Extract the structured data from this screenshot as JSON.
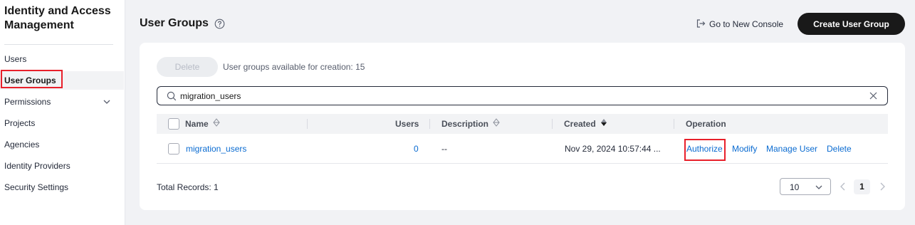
{
  "sidebar": {
    "title": "Identity and Access Management",
    "items": [
      {
        "label": "Users"
      },
      {
        "label": "User Groups"
      },
      {
        "label": "Permissions"
      },
      {
        "label": "Projects"
      },
      {
        "label": "Agencies"
      },
      {
        "label": "Identity Providers"
      },
      {
        "label": "Security Settings"
      }
    ]
  },
  "header": {
    "title": "User Groups",
    "go_new_console": "Go to New Console",
    "create_button": "Create User Group"
  },
  "toolbar": {
    "delete_label": "Delete",
    "available_text": "User groups available for creation: 15"
  },
  "search": {
    "value": "migration_users"
  },
  "table": {
    "columns": {
      "name": "Name",
      "users": "Users",
      "description": "Description",
      "created": "Created",
      "operation": "Operation"
    },
    "rows": [
      {
        "name": "migration_users",
        "users": "0",
        "description": "--",
        "created": "Nov 29, 2024 10:57:44 ...",
        "operations": [
          "Authorize",
          "Modify",
          "Manage User",
          "Delete"
        ]
      }
    ]
  },
  "footer": {
    "total_records": "Total Records: 1",
    "page_size": "10",
    "current_page": "1"
  },
  "colors": {
    "accent_link": "#0a6bd1",
    "primary_button": "#191919",
    "highlight_box": "#e8202b"
  }
}
